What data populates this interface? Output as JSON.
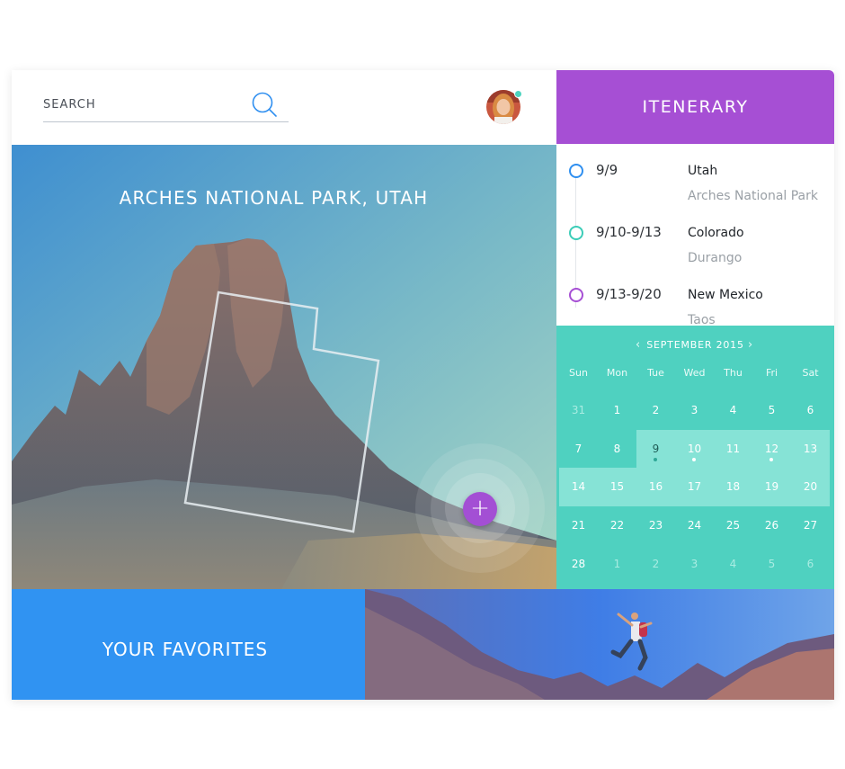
{
  "search": {
    "placeholder": "SEARCH",
    "value": ""
  },
  "user": {
    "online": true,
    "status_color": "#4dd3bf"
  },
  "hero": {
    "title": "ARCHES NATIONAL PARK, UTAH",
    "add_button": "+",
    "accent": "#a34fd4"
  },
  "favorites": {
    "title": "YOUR FAVORITES",
    "color": "#3093f2"
  },
  "itinerary": {
    "title": "ITENERARY",
    "color": "#a64fd4",
    "items": [
      {
        "dates": "9/9",
        "place": "Utah",
        "detail": "Arches National Park",
        "dot_color": "#2f8ff0"
      },
      {
        "dates": "9/10-9/13",
        "place": "Colorado",
        "detail": "Durango",
        "dot_color": "#3ccdb8"
      },
      {
        "dates": "9/13-9/20",
        "place": "New Mexico",
        "detail": "Taos",
        "dot_color": "#a64fd4"
      }
    ]
  },
  "calendar": {
    "month_label": "SEPTEMBER 2015",
    "prev_icon": "chevron-left-icon",
    "next_icon": "chevron-right-icon",
    "weekdays": [
      "Sun",
      "Mon",
      "Tue",
      "Wed",
      "Thu",
      "Fri",
      "Sat"
    ],
    "weeks": [
      [
        "31",
        "1",
        "2",
        "3",
        "4",
        "5",
        "6"
      ],
      [
        "7",
        "8",
        "9",
        "10",
        "11",
        "12",
        "13"
      ],
      [
        "14",
        "15",
        "16",
        "17",
        "18",
        "19",
        "20"
      ],
      [
        "21",
        "22",
        "23",
        "24",
        "25",
        "26",
        "27"
      ],
      [
        "28",
        "1",
        "2",
        "3",
        "4",
        "5",
        "6"
      ]
    ],
    "today": "9",
    "marked_days": [
      "9",
      "10",
      "12"
    ],
    "background": "#4fd1c0"
  }
}
